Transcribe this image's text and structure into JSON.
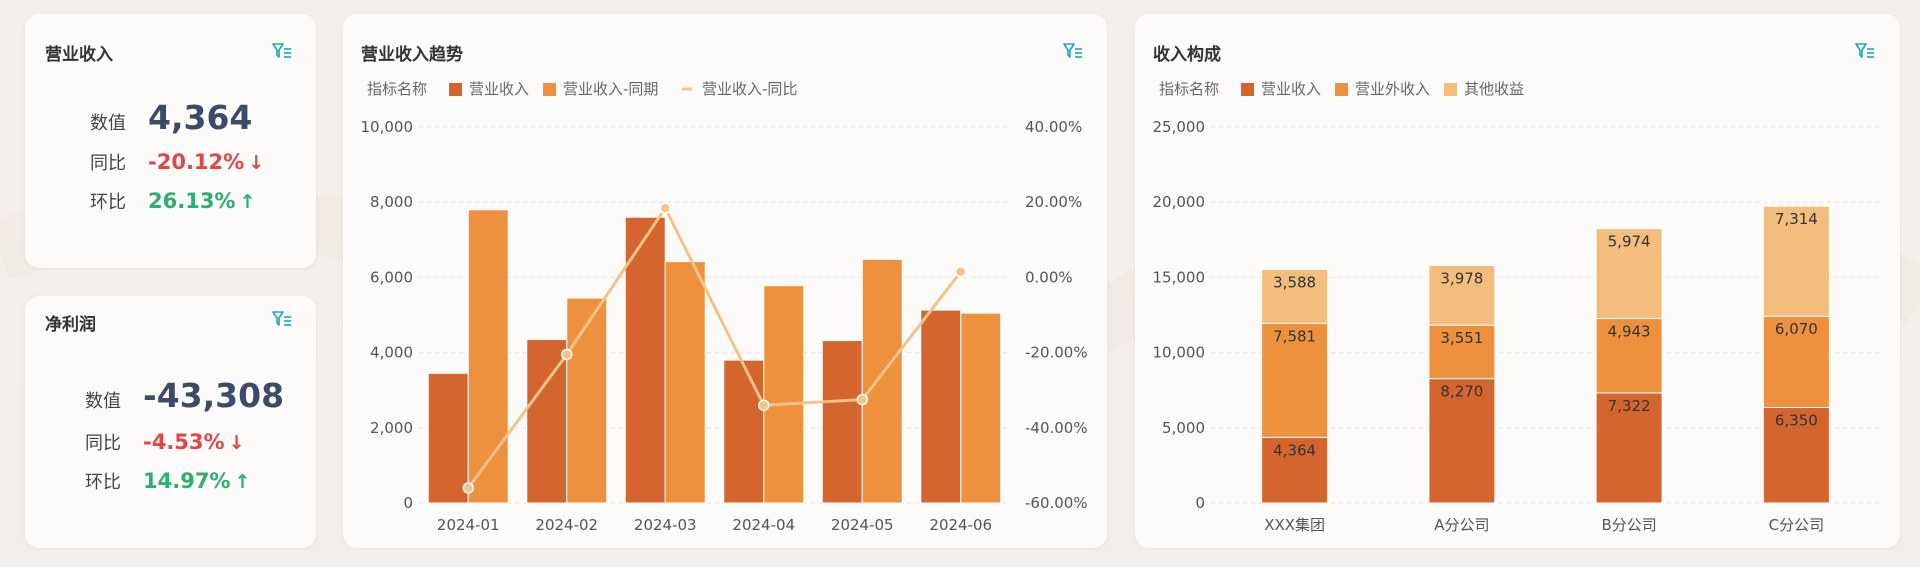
{
  "kpi_revenue": {
    "title": "营业收入",
    "value_label": "数值",
    "value": "4,364",
    "yoy_label": "同比",
    "yoy": "-20.12%",
    "yoy_arrow": "↓",
    "mom_label": "环比",
    "mom": "26.13%",
    "mom_arrow": "↑"
  },
  "kpi_profit": {
    "title": "净利润",
    "value_label": "数值",
    "value": "-43,308",
    "yoy_label": "同比",
    "yoy": "-4.53%",
    "yoy_arrow": "↓",
    "mom_label": "环比",
    "mom": "14.97%",
    "mom_arrow": "↑"
  },
  "colors": {
    "dark_orange": "#d4652f",
    "orange": "#ee913f",
    "light_orange": "#f3bd7d",
    "line": "#f3c38a",
    "filter_icon": "#1aa8b8"
  },
  "chart_data": [
    {
      "type": "bar",
      "title": "营业收入趋势",
      "legend_title": "指标名称",
      "legend_position": "top-left",
      "grid": true,
      "categories": [
        "2024-01",
        "2024-02",
        "2024-03",
        "2024-04",
        "2024-05",
        "2024-06"
      ],
      "series": [
        {
          "name": "营业收入",
          "type": "bar",
          "axis": "left",
          "values": [
            3450,
            4350,
            7600,
            3800,
            4320,
            5130
          ]
        },
        {
          "name": "营业收入-同期",
          "type": "bar",
          "axis": "left",
          "values": [
            7800,
            5450,
            6420,
            5780,
            6480,
            5050
          ]
        },
        {
          "name": "营业收入-同比",
          "type": "line",
          "axis": "right",
          "values": [
            -56,
            -20.5,
            18.4,
            -34,
            -32.5,
            1.5
          ]
        }
      ],
      "ylim": [
        0,
        10000
      ],
      "yticks": [
        "10,000",
        "8,000",
        "6,000",
        "4,000",
        "2,000",
        "0"
      ],
      "y2lim": [
        -60,
        40
      ],
      "y2ticks": [
        "40.00%",
        "20.00%",
        "0.00%",
        "-20.00%",
        "-40.00%",
        "-60.00%"
      ]
    },
    {
      "type": "bar",
      "stacked": true,
      "title": "收入构成",
      "legend_title": "指标名称",
      "legend_position": "top-left",
      "grid": true,
      "categories": [
        "XXX集团",
        "A分公司",
        "B分公司",
        "C分公司"
      ],
      "series": [
        {
          "name": "营业收入",
          "values": [
            4364,
            8270,
            7322,
            6350
          ],
          "labels": [
            "4,364",
            "8,270",
            "7,322",
            "6,350"
          ]
        },
        {
          "name": "营业外收入",
          "values": [
            7581,
            3551,
            4943,
            6070
          ],
          "labels": [
            "7,581",
            "3,551",
            "4,943",
            "6,070"
          ]
        },
        {
          "name": "其他收益",
          "values": [
            3588,
            3978,
            5974,
            7314
          ],
          "labels": [
            "3,588",
            "3,978",
            "5,974",
            "7,314"
          ]
        }
      ],
      "ylim": [
        0,
        25000
      ],
      "yticks": [
        "25,000",
        "20,000",
        "15,000",
        "10,000",
        "5,000",
        "0"
      ]
    }
  ]
}
